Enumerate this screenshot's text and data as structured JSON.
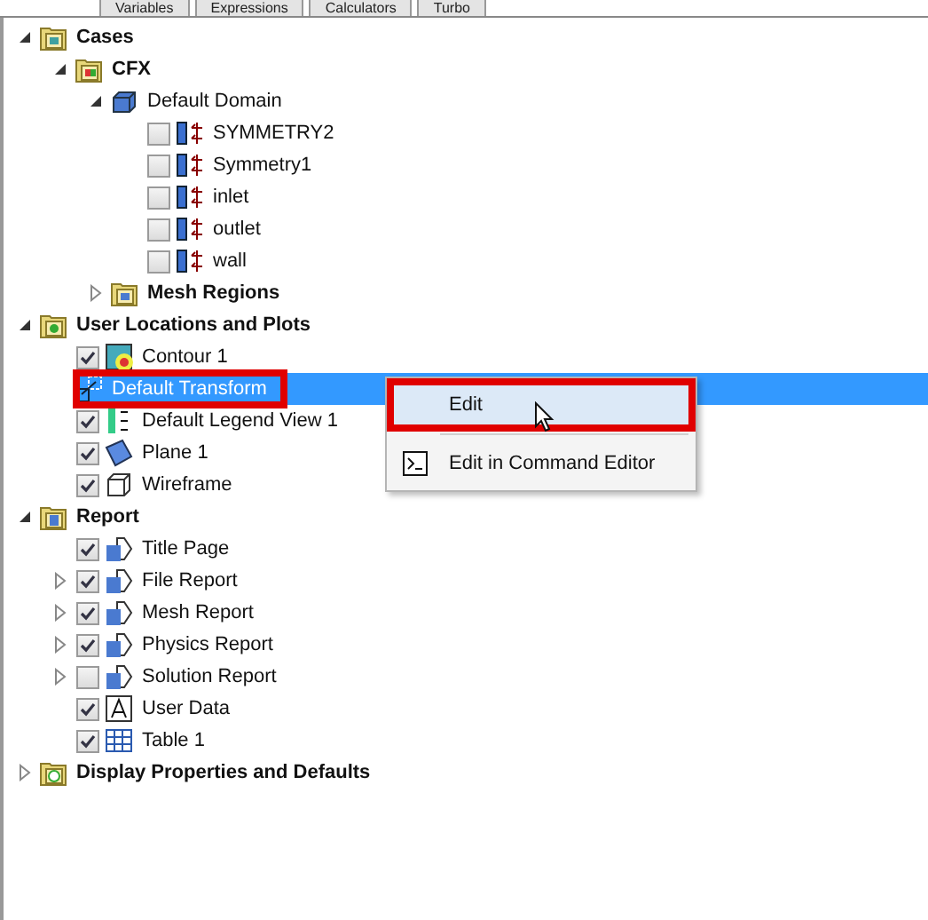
{
  "tabs": [
    {
      "label": "Variables",
      "selected": false
    },
    {
      "label": "Expressions",
      "selected": false
    },
    {
      "label": "Calculators",
      "selected": false
    },
    {
      "label": "Turbo",
      "selected": false
    }
  ],
  "tree": [
    {
      "label": "Cases",
      "kind": "cases",
      "bold": true,
      "expanded": true,
      "children": [
        {
          "label": "CFX",
          "kind": "cfx",
          "bold": true,
          "expanded": true,
          "children": [
            {
              "label": "Default Domain",
              "kind": "domain",
              "expanded": true,
              "children": [
                {
                  "label": "SYMMETRY2",
                  "kind": "boundary",
                  "checked": false
                },
                {
                  "label": "Symmetry1",
                  "kind": "boundary",
                  "checked": false
                },
                {
                  "label": "inlet",
                  "kind": "boundary",
                  "checked": false
                },
                {
                  "label": "outlet",
                  "kind": "boundary",
                  "checked": false
                },
                {
                  "label": "wall",
                  "kind": "boundary",
                  "checked": false
                }
              ]
            },
            {
              "label": "Mesh Regions",
              "kind": "mesh",
              "bold": true,
              "expanded": false
            }
          ]
        }
      ]
    },
    {
      "label": "User Locations and Plots",
      "kind": "plots",
      "bold": true,
      "expanded": true,
      "children": [
        {
          "label": "Contour 1",
          "kind": "contour",
          "checked": true
        },
        {
          "label": "Default Transform",
          "kind": "transform",
          "selected": true,
          "highlighted": true
        },
        {
          "label": "Default Legend View 1",
          "kind": "legend",
          "checked": true
        },
        {
          "label": "Plane 1",
          "kind": "plane",
          "checked": true
        },
        {
          "label": "Wireframe",
          "kind": "wireframe",
          "checked": true
        }
      ]
    },
    {
      "label": "Report",
      "kind": "reports",
      "bold": true,
      "expanded": true,
      "children": [
        {
          "label": "Title Page",
          "kind": "report",
          "checked": true
        },
        {
          "label": "File Report",
          "kind": "report",
          "checked": true,
          "expanded": false
        },
        {
          "label": "Mesh Report",
          "kind": "report",
          "checked": true,
          "expanded": false
        },
        {
          "label": "Physics Report",
          "kind": "report",
          "checked": true,
          "expanded": false
        },
        {
          "label": "Solution Report",
          "kind": "report",
          "checked": false,
          "expanded": false
        },
        {
          "label": "User Data",
          "kind": "text",
          "checked": true
        },
        {
          "label": "Table 1",
          "kind": "table",
          "checked": true
        }
      ]
    },
    {
      "label": "Display Properties and Defaults",
      "kind": "display",
      "bold": true,
      "expanded": false
    }
  ],
  "context_menu": {
    "items": [
      {
        "label": "Edit",
        "kind": "plain",
        "hovered": true,
        "highlighted": true
      },
      {
        "label": "Edit in Command Editor",
        "kind": "command",
        "hovered": false,
        "highlighted": false
      }
    ]
  }
}
